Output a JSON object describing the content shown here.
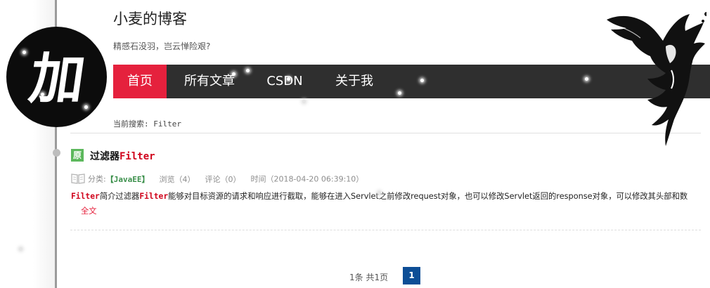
{
  "site": {
    "title": "小麦的博客",
    "subtitle": "精感石没羽，岂云惮险艰?"
  },
  "avatar": {
    "text": "加"
  },
  "nav": {
    "items": [
      {
        "label": "首页",
        "active": true
      },
      {
        "label": "所有文章",
        "active": false
      },
      {
        "label": "CSDN",
        "active": false
      },
      {
        "label": "关于我",
        "active": false
      }
    ]
  },
  "search": {
    "label": "当前搜索: Filter"
  },
  "article": {
    "badge": "原",
    "title_prefix": "过滤器",
    "title_highlight": "Filter",
    "meta": {
      "category_label": "分类:",
      "category": "【JavaEE】",
      "views": "浏览（4）",
      "comments": "评论（0）",
      "time": "时间（2018-04-20 06:39:10）"
    },
    "summary": {
      "hl1": "Filter",
      "part1": "简介过滤器",
      "hl2": "Filter",
      "part2": "能够对目标资源的请求和响应进行截取，能够在进入Servlet之前修改request对象，也可以修改Servlet返回的response对象，可以修改其头部和数",
      "more": "全文"
    }
  },
  "pagination": {
    "summary": "1条 共1页",
    "current_page": "1"
  },
  "colors": {
    "nav_bg": "#2f2f2f",
    "nav_active": "#e5213d",
    "highlight": "#d0021b",
    "badge": "#5cb85c",
    "pager": "#0d4e96"
  }
}
